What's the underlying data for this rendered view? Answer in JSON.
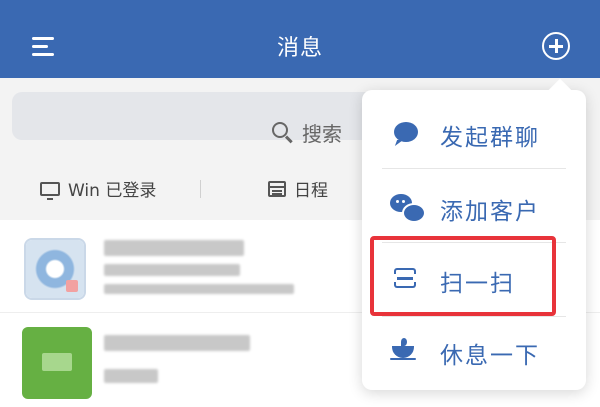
{
  "colors": {
    "primary": "#3a69b2",
    "highlight": "#e8333a"
  },
  "header": {
    "title": "消息",
    "menu_icon": "hamburger-menu-icon",
    "add_icon": "circle-plus-icon"
  },
  "search": {
    "placeholder": "搜索",
    "icon": "search-icon"
  },
  "quick_actions": {
    "win": {
      "label": "Win 已登录",
      "icon": "monitor-icon"
    },
    "schedule": {
      "label": "日程",
      "icon": "calendar-icon"
    }
  },
  "popup_menu": {
    "items": [
      {
        "label": "发起群聊",
        "icon": "chat-bubble-icon"
      },
      {
        "label": "添加客户",
        "icon": "customer-chat-icon"
      },
      {
        "label": "扫一扫",
        "icon": "scan-icon"
      },
      {
        "label": "休息一下",
        "icon": "coffee-cup-icon"
      }
    ]
  }
}
